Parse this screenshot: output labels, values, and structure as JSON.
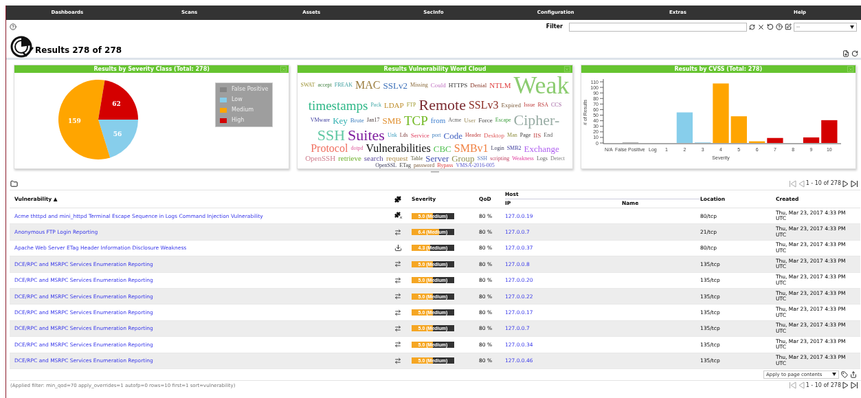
{
  "nav": [
    "Dashboards",
    "Scans",
    "Assets",
    "SecInfo",
    "Configuration",
    "Extras",
    "Help"
  ],
  "toolbar": {
    "filter_label": "Filter",
    "select": "--"
  },
  "page_title": "Results 278 of 278",
  "panels": [
    {
      "kind": "chart",
      "title": "Results by Severity Class (Total: 278)",
      "chart_data": {
        "type": "pie",
        "categories": [
          "False Positive",
          "Low",
          "Medium",
          "High"
        ],
        "colors": [
          "#858585",
          "#87ceeb",
          "#ffa500",
          "#d40000"
        ],
        "values": [
          0,
          56,
          159,
          62
        ],
        "data_labels": true
      }
    },
    {
      "kind": "cloud",
      "title": "Results Vulnerability Word Cloud",
      "words": [
        {
          "text": "SWAT",
          "kind": "tiny"
        },
        {
          "text": "accept",
          "kind": "tiny"
        },
        {
          "text": "FREAK",
          "kind": "tiny"
        },
        {
          "text": "MAC",
          "kind": "ml"
        },
        {
          "text": "SSLv2",
          "kind": "m"
        },
        {
          "text": "Missing",
          "kind": "tiny"
        },
        {
          "text": "Could",
          "kind": "xs"
        },
        {
          "text": "HTTPS",
          "kind": "xs"
        },
        {
          "text": "Denial",
          "kind": "xs"
        },
        {
          "text": "NTLM",
          "kind": "s"
        },
        {
          "text": "Weak",
          "kind": "huge"
        },
        {
          "text": "timestamps",
          "kind": "l"
        },
        {
          "text": "Pack",
          "kind": "tiny"
        },
        {
          "text": "LDAP",
          "kind": "s"
        },
        {
          "text": "FTP",
          "kind": "tiny"
        },
        {
          "text": "Remote",
          "kind": "xl"
        },
        {
          "text": "SSLv3",
          "kind": "ml"
        },
        {
          "text": "Expired",
          "kind": "xs"
        },
        {
          "text": "Issue",
          "kind": "tiny"
        },
        {
          "text": "RSA",
          "kind": "tiny"
        },
        {
          "text": "CCS",
          "kind": "tiny"
        },
        {
          "text": "VMware",
          "kind": "tiny"
        },
        {
          "text": "Key",
          "kind": "m"
        },
        {
          "text": "Brute",
          "kind": "xs"
        },
        {
          "text": "Jan17",
          "kind": "xxs"
        },
        {
          "text": "SMB",
          "kind": "m"
        },
        {
          "text": "TCP",
          "kind": "l"
        },
        {
          "text": "from",
          "kind": "s"
        },
        {
          "text": "Acme",
          "kind": "tiny"
        },
        {
          "text": "User",
          "kind": "xs"
        },
        {
          "text": "Force",
          "kind": "xs"
        },
        {
          "text": "Escape",
          "kind": "tiny"
        },
        {
          "text": "Cipher-",
          "kind": "xl"
        },
        {
          "text": "SSH",
          "kind": "xl"
        },
        {
          "text": "Suites",
          "kind": "xl"
        },
        {
          "text": "Unk",
          "kind": "tiny"
        },
        {
          "text": "Lds",
          "kind": "tiny"
        },
        {
          "text": "Service",
          "kind": "xs"
        },
        {
          "text": "port",
          "kind": "tiny"
        },
        {
          "text": "Code",
          "kind": "m"
        },
        {
          "text": "Header",
          "kind": "tiny"
        },
        {
          "text": "Desktop",
          "kind": "xs"
        },
        {
          "text": "Man",
          "kind": "tiny"
        },
        {
          "text": "Page",
          "kind": "tiny"
        },
        {
          "text": "IIS",
          "kind": "xs"
        },
        {
          "text": "End",
          "kind": "tiny"
        },
        {
          "text": "Protocol",
          "kind": "ml"
        },
        {
          "text": "dotpd",
          "kind": "tiny"
        },
        {
          "text": "Vulnerabilities",
          "kind": "ml"
        },
        {
          "text": "CBC",
          "kind": "m"
        },
        {
          "text": "SMBv1",
          "kind": "ml"
        },
        {
          "text": "Login",
          "kind": "tiny"
        },
        {
          "text": "SMB2",
          "kind": "tiny"
        },
        {
          "text": "Exchange",
          "kind": "m"
        },
        {
          "text": "OpenSSH",
          "kind": "s"
        },
        {
          "text": "retrieve",
          "kind": "s"
        },
        {
          "text": "search",
          "kind": "s"
        },
        {
          "text": "request",
          "kind": "s"
        },
        {
          "text": "Table",
          "kind": "tiny"
        },
        {
          "text": "Server",
          "kind": "m"
        },
        {
          "text": "Group",
          "kind": "m"
        },
        {
          "text": "SSH",
          "kind": "tiny"
        },
        {
          "text": "scripting",
          "kind": "tiny"
        },
        {
          "text": "Weakness",
          "kind": "tiny"
        },
        {
          "text": "Logs",
          "kind": "tiny"
        },
        {
          "text": "Detect",
          "kind": "tiny"
        },
        {
          "text": "OpenSSL",
          "kind": "tiny"
        },
        {
          "text": "ETag",
          "kind": "tiny"
        },
        {
          "text": "password",
          "kind": "tiny"
        },
        {
          "text": "Bypass",
          "kind": "xxs"
        },
        {
          "text": "VMSA-2016-005",
          "kind": "tiny"
        }
      ]
    },
    {
      "kind": "chart",
      "title": "Results by CVSS (Total: 278)",
      "chart_data": {
        "type": "bar",
        "xlabel": "Severity",
        "ylabel": "# of Results",
        "categories": [
          "N/A",
          "False Positive",
          "Log",
          "1",
          "2",
          "3",
          "4",
          "5",
          "6",
          "7",
          "8",
          "9",
          "10"
        ],
        "yticks": [
          0,
          10,
          20,
          30,
          40,
          50,
          60,
          70,
          80,
          90,
          100,
          110
        ],
        "ylim": [
          0,
          110
        ],
        "values": [
          0,
          1,
          0,
          0,
          55,
          1,
          107,
          48,
          3,
          9,
          0,
          10,
          41
        ],
        "colors": [
          null,
          "#a0a0a0",
          null,
          null,
          "#87ceeb",
          "#87ceeb",
          "#ffa500",
          "#ffa500",
          "#ffa500",
          "#d40000",
          null,
          "#d40000",
          "#d40000"
        ]
      }
    }
  ],
  "pagination_top": "1 - 10 of 278",
  "table": {
    "columns": {
      "vulnerability": "Vulnerability ▲",
      "severity": "Severity",
      "qod": "QoD",
      "host": "Host",
      "ip": "IP",
      "name": "Name",
      "location": "Location",
      "created": "Created"
    },
    "rows": [
      {
        "vulnerability": "Acme thttpd and mini_httpd Terminal Escape Sequence in Logs Command Injection Vulnerability",
        "kind": "nofix",
        "severity": "5.0 (Medium)",
        "level": 0.5,
        "qod": "80 %",
        "ip": "127.0.0.19",
        "location": "80/tcp",
        "created": "Thu, Mar 23, 2017 4:33 PM UTC"
      },
      {
        "vulnerability": "Anonymous FTP Login Reporting",
        "kind": "mitigation",
        "severity": "6.4 (Medium)",
        "level": 0.64,
        "qod": "80 %",
        "ip": "127.0.0.7",
        "location": "21/tcp",
        "created": "Thu, Mar 23, 2017 4:33 PM UTC"
      },
      {
        "vulnerability": "Apache Web Server ETag Header Information Disclosure Weakness",
        "kind": "vendorfix",
        "severity": "4.3 (Medium)",
        "level": 0.43,
        "qod": "80 %",
        "ip": "127.0.0.37",
        "location": "80/tcp",
        "created": "Thu, Mar 23, 2017 4:33 PM UTC"
      },
      {
        "vulnerability": "DCE/RPC and MSRPC Services Enumeration Reporting",
        "kind": "mitigation",
        "severity": "5.0 (Medium)",
        "level": 0.5,
        "qod": "80 %",
        "ip": "127.0.0.8",
        "location": "135/tcp",
        "created": "Thu, Mar 23, 2017 4:33 PM UTC"
      },
      {
        "vulnerability": "DCE/RPC and MSRPC Services Enumeration Reporting",
        "kind": "mitigation",
        "severity": "5.0 (Medium)",
        "level": 0.5,
        "qod": "80 %",
        "ip": "127.0.0.20",
        "location": "135/tcp",
        "created": "Thu, Mar 23, 2017 4:33 PM UTC"
      },
      {
        "vulnerability": "DCE/RPC and MSRPC Services Enumeration Reporting",
        "kind": "mitigation",
        "severity": "5.0 (Medium)",
        "level": 0.5,
        "qod": "80 %",
        "ip": "127.0.0.22",
        "location": "135/tcp",
        "created": "Thu, Mar 23, 2017 4:33 PM UTC"
      },
      {
        "vulnerability": "DCE/RPC and MSRPC Services Enumeration Reporting",
        "kind": "mitigation",
        "severity": "5.0 (Medium)",
        "level": 0.5,
        "qod": "80 %",
        "ip": "127.0.0.17",
        "location": "135/tcp",
        "created": "Thu, Mar 23, 2017 4:33 PM UTC"
      },
      {
        "vulnerability": "DCE/RPC and MSRPC Services Enumeration Reporting",
        "kind": "mitigation",
        "severity": "5.0 (Medium)",
        "level": 0.5,
        "qod": "80 %",
        "ip": "127.0.0.7",
        "location": "135/tcp",
        "created": "Thu, Mar 23, 2017 4:33 PM UTC"
      },
      {
        "vulnerability": "DCE/RPC and MSRPC Services Enumeration Reporting",
        "kind": "mitigation",
        "severity": "5.0 (Medium)",
        "level": 0.5,
        "qod": "80 %",
        "ip": "127.0.0.34",
        "location": "135/tcp",
        "created": "Thu, Mar 23, 2017 4:33 PM UTC"
      },
      {
        "vulnerability": "DCE/RPC and MSRPC Services Enumeration Reporting",
        "kind": "mitigation",
        "severity": "5.0 (Medium)",
        "level": 0.5,
        "qod": "80 %",
        "ip": "127.0.0.46",
        "location": "135/tcp",
        "created": "Thu, Mar 23, 2017 4:33 PM UTC"
      }
    ]
  },
  "bulk_action": "Apply to page contents",
  "pagination_bottom": "1 - 10 of 278",
  "applied_filter": "(Applied filter: min_qod=70 apply_overrides=1 autofp=0 rows=10 first=1 sort=vulnerability)"
}
